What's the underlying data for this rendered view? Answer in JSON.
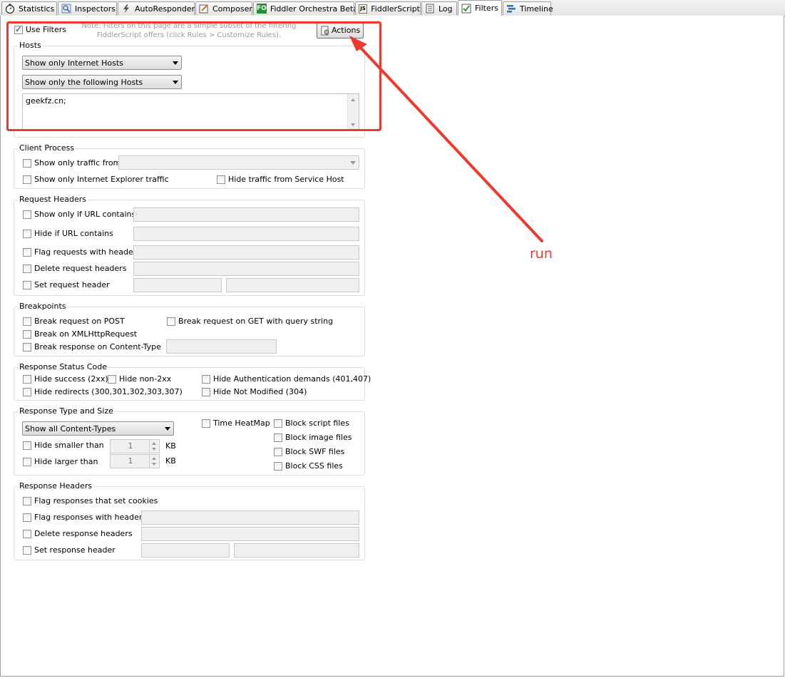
{
  "tabs": [
    {
      "label": "Statistics",
      "icon": "stopwatch-icon"
    },
    {
      "label": "Inspectors",
      "icon": "magnifier-icon"
    },
    {
      "label": "AutoResponder",
      "icon": "lightning-icon"
    },
    {
      "label": "Composer",
      "icon": "pencil-icon"
    },
    {
      "label": "Fiddler Orchestra Beta",
      "icon": "fo-icon",
      "icon_text": "FO"
    },
    {
      "label": "FiddlerScript",
      "icon": "script-icon",
      "icon_text": "JS"
    },
    {
      "label": "Log",
      "icon": "log-icon"
    },
    {
      "label": "Filters",
      "icon": "checkbox-icon"
    },
    {
      "label": "Timeline",
      "icon": "timeline-icon"
    }
  ],
  "filters": {
    "use_filters": "Use Filters",
    "note": "Note: Filters on this page are a simple subset of the filtering FiddlerScript offers (click Rules > Customize Rules).",
    "actions": "Actions"
  },
  "hosts": {
    "legend": "Hosts",
    "zone_select": "Show only Internet Hosts",
    "host_select": "Show only the following Hosts",
    "host_list": "geekfz.cn;"
  },
  "client_process": {
    "legend": "Client Process",
    "show_traffic_from": "Show only traffic from",
    "show_ie": "Show only Internet Explorer traffic",
    "hide_service_host": "Hide traffic from Service Host"
  },
  "request_headers": {
    "legend": "Request Headers",
    "show_url": "Show only if URL contains",
    "hide_url": "Hide if URL contains",
    "flag_headers": "Flag requests with headers",
    "delete_headers": "Delete request headers",
    "set_header": "Set request header"
  },
  "breakpoints": {
    "legend": "Breakpoints",
    "break_post": "Break request on POST",
    "break_get": "Break request on GET with query string",
    "break_xhr": "Break on XMLHttpRequest",
    "break_content_type": "Break response on Content-Type"
  },
  "status_code": {
    "legend": "Response Status Code",
    "hide_success": "Hide success (2xx)",
    "hide_non2xx": "Hide non-2xx",
    "hide_auth": "Hide Authentication demands (401,407)",
    "hide_redirects": "Hide redirects (300,301,302,303,307)",
    "hide_not_modified": "Hide Not Modified (304)"
  },
  "type_size": {
    "legend": "Response Type and Size",
    "content_select": "Show all Content-Types",
    "time_heatmap": "Time HeatMap",
    "block_script": "Block script files",
    "block_image": "Block image files",
    "block_swf": "Block SWF files",
    "block_css": "Block CSS files",
    "hide_smaller": "Hide smaller than",
    "hide_larger": "Hide larger than",
    "smaller_value": "1",
    "larger_value": "1",
    "unit": "KB"
  },
  "response_headers": {
    "legend": "Response Headers",
    "flag_cookies": "Flag responses that set cookies",
    "flag_headers": "Flag responses with headers",
    "delete_headers": "Delete response headers",
    "set_header": "Set response header"
  },
  "annotation": {
    "text": "run",
    "color": "#ee3a2e"
  }
}
